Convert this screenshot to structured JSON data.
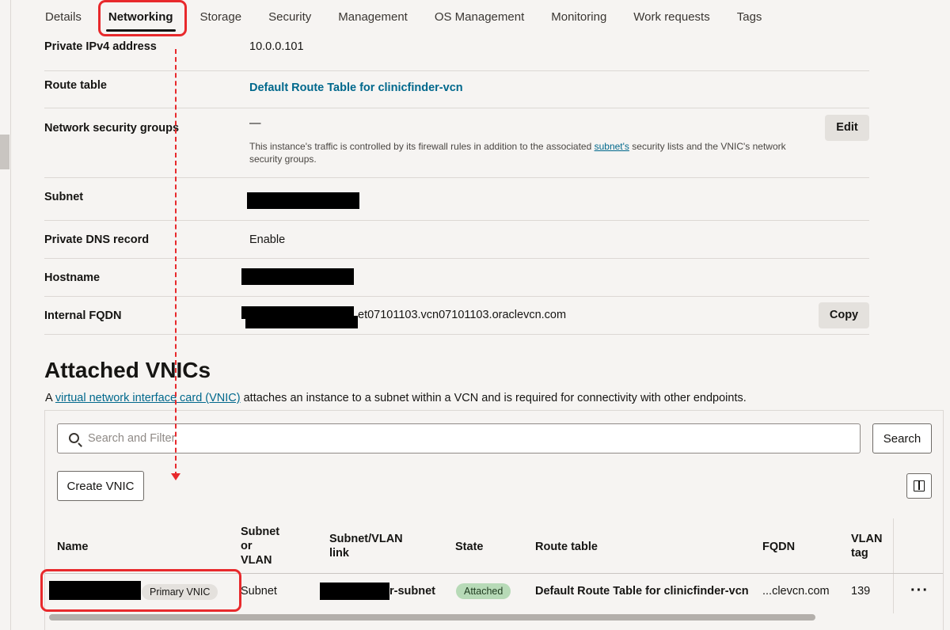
{
  "tabs": [
    {
      "label": "Details"
    },
    {
      "label": "Networking"
    },
    {
      "label": "Storage"
    },
    {
      "label": "Security"
    },
    {
      "label": "Management"
    },
    {
      "label": "OS Management"
    },
    {
      "label": "Monitoring"
    },
    {
      "label": "Work requests"
    },
    {
      "label": "Tags"
    }
  ],
  "active_tab": "Networking",
  "details": {
    "private_ipv4": {
      "label": "Private IPv4 address",
      "value": "10.0.0.101"
    },
    "route_table": {
      "label": "Route table",
      "value": "Default Route Table for clinicfinder-vcn"
    },
    "nsg": {
      "label": "Network security groups",
      "value": "—",
      "help_prefix": "This instance's traffic is controlled by its firewall rules in addition to the associated ",
      "help_link": "subnet's",
      "help_suffix": " security lists and the VNIC's network security groups.",
      "edit_label": "Edit"
    },
    "subnet": {
      "label": "Subnet"
    },
    "private_dns": {
      "label": "Private DNS record",
      "value": "Enable"
    },
    "hostname": {
      "label": "Hostname"
    },
    "fqdn": {
      "label": "Internal FQDN",
      "value_suffix": "et07101103.vcn07101103.oraclevcn.com",
      "copy_label": "Copy"
    }
  },
  "vnics": {
    "title": "Attached VNICs",
    "desc_prefix": "A ",
    "desc_link": "virtual network interface card (VNIC)",
    "desc_suffix": " attaches an instance to a subnet within a VCN and is required for connectivity with other endpoints.",
    "search_placeholder": "Search and Filter",
    "search_button": "Search",
    "create_button": "Create VNIC",
    "columns": {
      "name": "Name",
      "subnet_or_vlan": [
        "Subnet",
        "or",
        "VLAN"
      ],
      "link": [
        "Subnet/VLAN",
        "link"
      ],
      "state": "State",
      "route_table": "Route table",
      "fqdn": "FQDN",
      "vlan_tag": [
        "VLAN",
        "tag"
      ]
    },
    "rows": [
      {
        "primary_badge": "Primary VNIC",
        "subnet_or_vlan": "Subnet",
        "link_suffix": "r-subnet",
        "state": "Attached",
        "route_table": "Default Route Table for clinicfinder-vcn",
        "fqdn": "...clevcn.com",
        "vlan_tag": "139",
        "actions": "···"
      }
    ]
  },
  "colors": {
    "highlight": "#e8292c",
    "link": "#00688c",
    "attached_badge": "#b7dab7"
  }
}
